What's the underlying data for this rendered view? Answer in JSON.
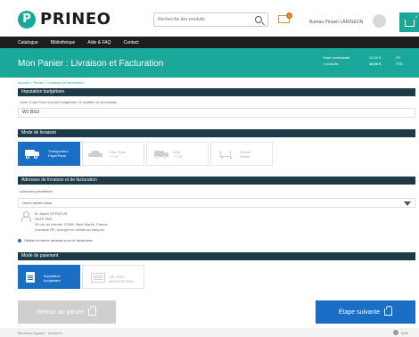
{
  "header": {
    "logo_text": "PRINEO",
    "logo_letter": "P",
    "search_placeholder": "Recherche des produits",
    "notif_count": "0",
    "user_name": "Bureau Pinuen LARIGEON",
    "cart_count": "0"
  },
  "nav": {
    "items": [
      "Catalogue",
      "Bibliothèque",
      "Aide & FAQ",
      "Contact"
    ]
  },
  "banner": {
    "title": "Mon Panier : Livraison et Facturation",
    "summary_line1": "Votre commande",
    "summary_line2": "1 produits",
    "ht_label": "12,00 €",
    "ht_value": "12,00 €",
    "ttc_label": "HT",
    "ttc_value": "TTC"
  },
  "breadcrumb": "Accueil > Panier > Livraison et facturation",
  "imputation": {
    "title": "Imputation budgétaire",
    "subtitle": "Votre Code Prom d'ordre budgétaire, la modifier si nécessaire",
    "value": "W1 BSU"
  },
  "delivery": {
    "title": "Mode de livraison",
    "options": [
      {
        "label_line1": "Transporteur",
        "label_line2": "PaperPane"
      },
      {
        "label_line1": "Uber Eats",
        "label_line2": "+ 0 €"
      },
      {
        "label_line1": "DHL",
        "label_line2": "+ 0 €"
      },
      {
        "label_line1": "Retrait",
        "label_line2": "Atelier"
      }
    ]
  },
  "addresses": {
    "title": "Adresses de livraison et de facturation",
    "sub": "Adresses prédéfinies",
    "select_value": "Home sweet home",
    "lines": [
      "M. Adam ISTRATUR",
      "DATE PBD",
      "28 rue du chemin, 07800 Saint-Martin, France",
      "Domaine RE, envoyer en cellule au campus"
    ],
    "checkbox_label": "Utiliser la même adresse pour la facturation"
  },
  "payment": {
    "title": "Mode de paiement",
    "options": [
      {
        "label_line1": "Imputation",
        "label_line2": "budgétaire"
      },
      {
        "label_line1": "CB, VISA,",
        "label_line2": "MASTERCARD"
      }
    ]
  },
  "buttons": {
    "back": "Retour au panier",
    "next": "Étape suivante"
  },
  "footer": {
    "text": "Mentions légales · Données",
    "help": "Aide"
  }
}
